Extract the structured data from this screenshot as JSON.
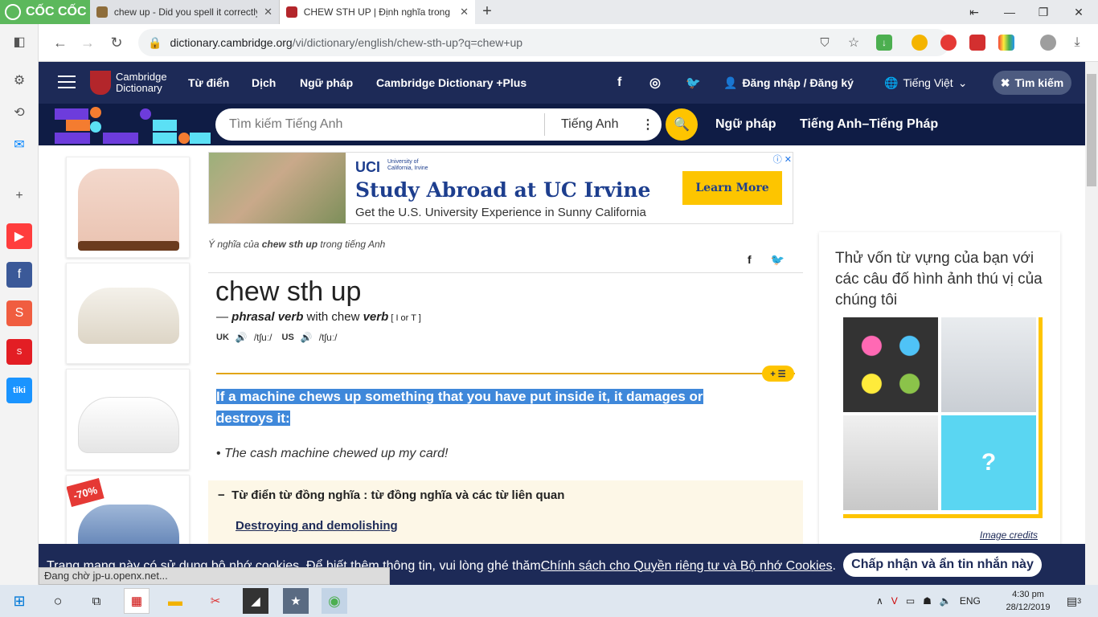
{
  "browser": {
    "brand": "CỐC CỐC",
    "tabs": [
      {
        "title": "chew up - Did you spell it correctly"
      },
      {
        "title": "CHEW STH UP | Định nghĩa trong"
      }
    ],
    "url_domain": "dictionary.cambridge.org",
    "url_path": "/vi/dictionary/english/chew-sth-up?q=chew+up",
    "status_text": "Đang chờ jp-u.openx.net..."
  },
  "site_header": {
    "logo_line1": "Cambridge",
    "logo_line2": "Dictionary",
    "nav": [
      "Từ điển",
      "Dịch",
      "Ngữ pháp",
      "Cambridge Dictionary +Plus"
    ],
    "login": "Đăng nhập / Đăng ký",
    "language": "Tiếng Việt",
    "search_toggle": "Tìm kiếm"
  },
  "search": {
    "placeholder": "Tìm kiếm Tiếng Anh",
    "language": "Tiếng Anh",
    "links": [
      "Ngữ pháp",
      "Tiếng Anh–Tiếng Pháp"
    ]
  },
  "ad_banner": {
    "uci": "UCI",
    "uci_sub1": "University of",
    "uci_sub2": "California, Irvine",
    "headline": "Study Abroad at UC Irvine",
    "subline": "Get the U.S. University Experience in Sunny California",
    "cta": "Learn More"
  },
  "left_ads": {
    "discount": "-70%"
  },
  "entry": {
    "breadcrumb_pre": "Ý nghĩa của ",
    "breadcrumb_word": "chew sth up",
    "breadcrumb_post": " trong tiếng Anh",
    "headword": "chew sth up",
    "pos_dash": "— ",
    "pos": "phrasal verb",
    "with_text": " with chew ",
    "pos2": "verb",
    "grammar": " [ I or T ]",
    "uk_label": "UK",
    "uk_ipa": "/tʃuː/",
    "us_label": "US",
    "us_ipa": "/tʃuː/",
    "definition": "If a machine chews up something that you have put inside it, it damages or destroys it:",
    "example": "The cash machine chewed up my card!",
    "synonyms_heading": "Từ điển từ đồng nghĩa : từ đồng nghĩa và các từ liên quan",
    "synonym_link": "Destroying and demolishing"
  },
  "quiz": {
    "text": "Thử vốn từ vựng của bạn với các câu đố hình ảnh thú vị của chúng tôi",
    "credits": "Image credits"
  },
  "cookie": {
    "text": "Trang mạng này có sử dụng bộ nhớ cookies. Để biết thêm thông tin, vui lòng ghé thăm ",
    "link": "Chính sách cho Quyền riêng tư và Bộ nhớ Cookies",
    "end": ".",
    "button": "Chấp nhận và ẩn tin nhắn này"
  },
  "taskbar": {
    "lang": "ENG",
    "time": "4:30 pm",
    "date": "28/12/2019",
    "notifications": "3"
  },
  "colors": {
    "site_navy": "#1d2a57",
    "accent_yellow": "#fec400",
    "highlight": "#3f88da"
  }
}
